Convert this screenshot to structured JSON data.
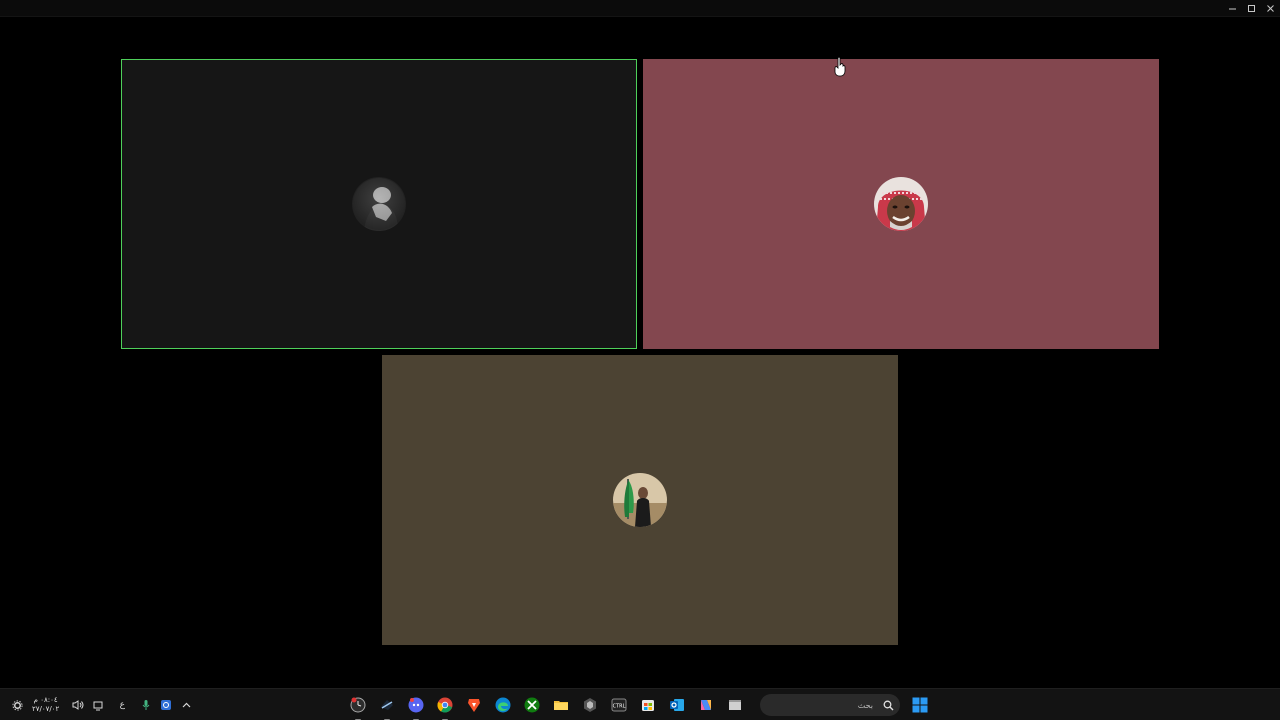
{
  "window": {
    "controls": [
      "minimize-icon",
      "maximize-icon",
      "close-icon"
    ]
  },
  "participants": [
    {
      "id": "tile-1",
      "speaking": true,
      "background": "#161616",
      "border": "#4ed05a",
      "avatar": "grayscale-profile-photo"
    },
    {
      "id": "tile-2",
      "speaking": false,
      "background": "#83474f",
      "avatar": "man-with-red-shemagh-photo"
    },
    {
      "id": "tile-3",
      "speaking": false,
      "background": "#4c4333",
      "avatar": "person-with-green-flag-photo"
    }
  ],
  "taskbar": {
    "clock": {
      "time": "٠٨:٠٤ م",
      "date": "٢٧/٠٧/٠٢"
    },
    "tray": {
      "language": "ع"
    },
    "search": {
      "placeholder": "بحث"
    },
    "apps": [
      "clock-app-icon",
      "steam-icon",
      "discord-icon",
      "chrome-icon",
      "brave-icon",
      "edge-icon",
      "xbox-icon",
      "file-explorer-icon",
      "app-icon",
      "ctrl-app-icon",
      "microsoft-store-icon",
      "outlook-icon",
      "copilot-icon",
      "window-icon"
    ]
  },
  "colors": {
    "speaking_border": "#4ed05a",
    "taskbar_bg": "#131313",
    "start_blue": "#1e90ff"
  }
}
